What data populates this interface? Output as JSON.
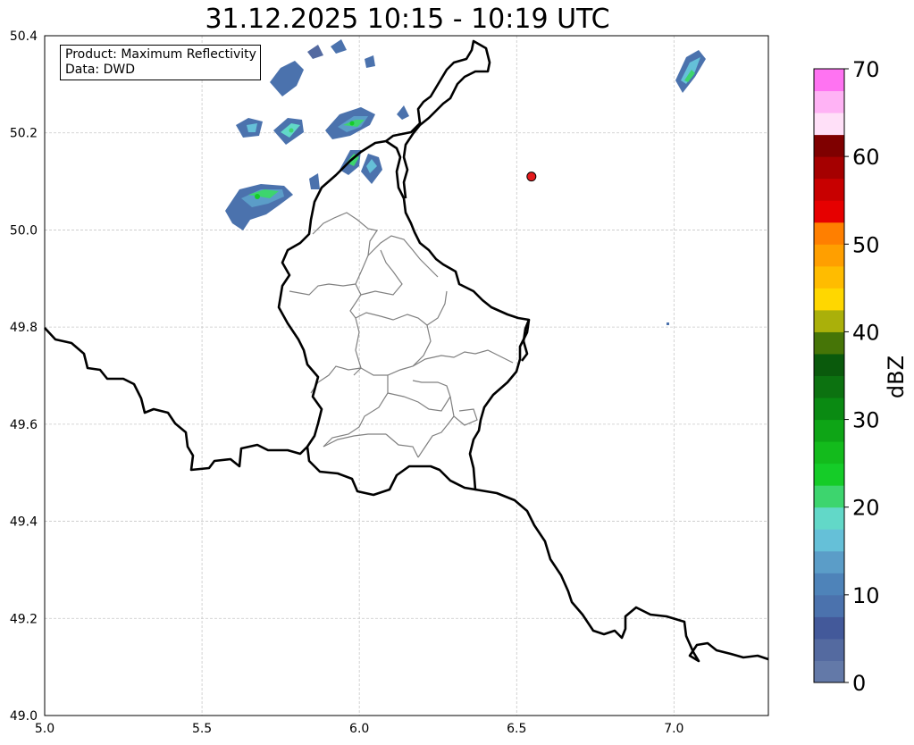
{
  "title": "31.12.2025 10:15 - 10:19 UTC",
  "info_box": {
    "product_line": "Product: Maximum Reflectivity",
    "data_line": "Data: DWD"
  },
  "map": {
    "lon_range": [
      5.0,
      7.3
    ],
    "lat_range": [
      49.0,
      50.4
    ],
    "x_ticks": [
      "5.0",
      "5.5",
      "6.0",
      "6.5",
      "7.0"
    ],
    "y_ticks": [
      "49.0",
      "49.2",
      "49.4",
      "49.6",
      "49.8",
      "50.0",
      "50.2",
      "50.4"
    ],
    "gridlines": true,
    "marker": {
      "lon": 6.547,
      "lat": 50.11,
      "color": "#e31a1c"
    },
    "country_border_color": "#000000",
    "region_border_color": "#808080"
  },
  "colorbar": {
    "label": "dBZ",
    "range": [
      0,
      70
    ],
    "tick_labels": [
      "0",
      "10",
      "20",
      "30",
      "40",
      "50",
      "60",
      "70"
    ],
    "colors": [
      "#6379a8",
      "#546aa0",
      "#43599a",
      "#4b72ad",
      "#4e83b9",
      "#5b9dc8",
      "#65c0d8",
      "#62d8c8",
      "#3dd56e",
      "#15cc28",
      "#13bb1c",
      "#0ea516",
      "#0a8a12",
      "#0c7210",
      "#0a5a0c",
      "#467507",
      "#aab00a",
      "#ffd700",
      "#ffbc00",
      "#ff9f00",
      "#ff7f00",
      "#e60000",
      "#c80000",
      "#a50000",
      "#7f0000",
      "#ffe0f8",
      "#ffb3f5",
      "#ff73f2",
      "#f03ce6"
    ]
  },
  "echoes": [
    {
      "lon": 5.6,
      "lat": 50.05,
      "type": "cluster"
    },
    {
      "lon": 5.7,
      "lat": 50.08,
      "type": "cluster"
    },
    {
      "lon": 5.65,
      "lat": 50.2,
      "type": "cluster"
    },
    {
      "lon": 5.78,
      "lat": 50.2,
      "type": "cluster"
    },
    {
      "lon": 5.8,
      "lat": 50.32,
      "type": "cluster"
    },
    {
      "lon": 5.97,
      "lat": 50.22,
      "type": "cluster"
    },
    {
      "lon": 5.98,
      "lat": 50.13,
      "type": "cluster"
    },
    {
      "lon": 6.04,
      "lat": 50.12,
      "type": "cluster"
    },
    {
      "lon": 7.05,
      "lat": 50.33,
      "type": "cluster"
    }
  ]
}
